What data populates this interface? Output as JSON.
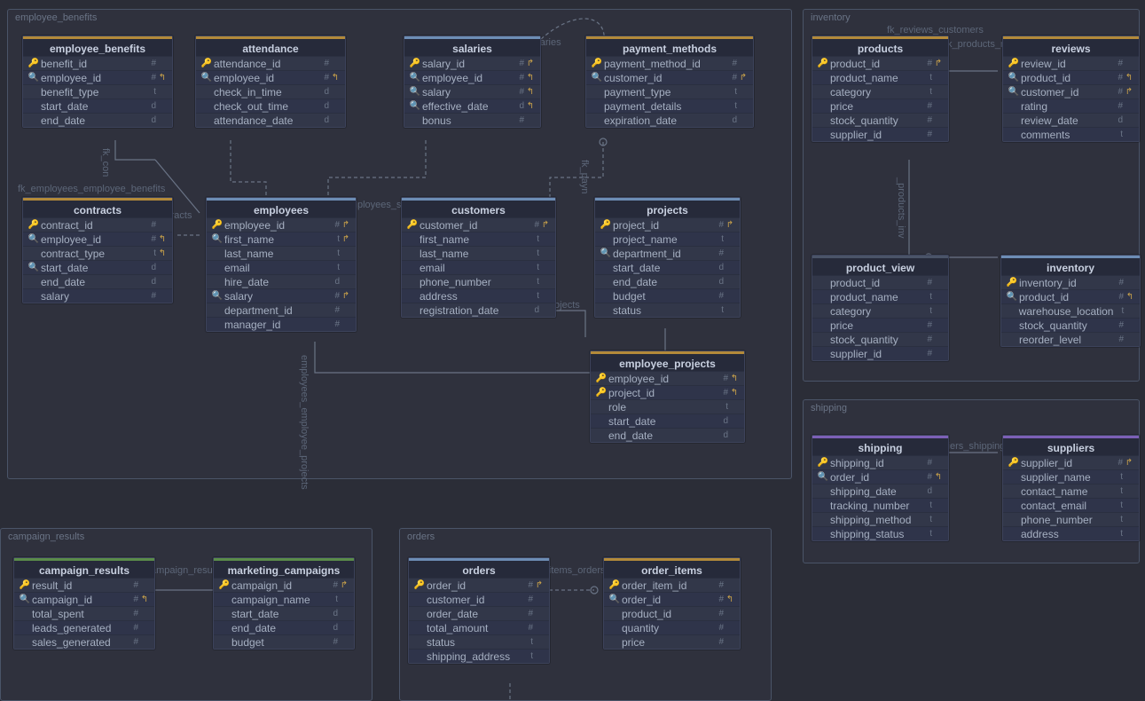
{
  "groups": {
    "employee_benefits": {
      "label": "employee_benefits"
    },
    "inventory": {
      "label": "inventory"
    },
    "shipping": {
      "label": "shipping"
    },
    "campaign_results": {
      "label": "campaign_results"
    },
    "orders": {
      "label": "orders"
    }
  },
  "entities": {
    "employee_benefits": {
      "title": "employee_benefits",
      "cols": [
        {
          "icon": "pk",
          "name": "benefit_id",
          "type": "#"
        },
        {
          "icon": "fk",
          "name": "employee_id",
          "type": "#",
          "link": "↰"
        },
        {
          "icon": "",
          "name": "benefit_type",
          "type": "t"
        },
        {
          "icon": "",
          "name": "start_date",
          "type": "d"
        },
        {
          "icon": "",
          "name": "end_date",
          "type": "d"
        }
      ]
    },
    "attendance": {
      "title": "attendance",
      "cols": [
        {
          "icon": "pk",
          "name": "attendance_id",
          "type": "#"
        },
        {
          "icon": "fk",
          "name": "employee_id",
          "type": "#",
          "link": "↰"
        },
        {
          "icon": "",
          "name": "check_in_time",
          "type": "d"
        },
        {
          "icon": "",
          "name": "check_out_time",
          "type": "d"
        },
        {
          "icon": "",
          "name": "attendance_date",
          "type": "d"
        }
      ]
    },
    "salaries": {
      "title": "salaries",
      "cols": [
        {
          "icon": "pk",
          "name": "salary_id",
          "type": "#",
          "link": "↱"
        },
        {
          "icon": "fk",
          "name": "employee_id",
          "type": "#",
          "link": "↰"
        },
        {
          "icon": "fk",
          "name": "salary",
          "type": "#",
          "link": "↰"
        },
        {
          "icon": "fk",
          "name": "effective_date",
          "type": "d",
          "link": "↰"
        },
        {
          "icon": "",
          "name": "bonus",
          "type": "#"
        }
      ]
    },
    "payment_methods": {
      "title": "payment_methods",
      "cols": [
        {
          "icon": "pk",
          "name": "payment_method_id",
          "type": "#"
        },
        {
          "icon": "fk",
          "name": "customer_id",
          "type": "#",
          "link": "↱"
        },
        {
          "icon": "",
          "name": "payment_type",
          "type": "t"
        },
        {
          "icon": "",
          "name": "payment_details",
          "type": "t"
        },
        {
          "icon": "",
          "name": "expiration_date",
          "type": "d"
        }
      ]
    },
    "contracts": {
      "title": "contracts",
      "cols": [
        {
          "icon": "pk",
          "name": "contract_id",
          "type": "#"
        },
        {
          "icon": "fk",
          "name": "employee_id",
          "type": "#",
          "link": "↰"
        },
        {
          "icon": "",
          "name": "contract_type",
          "type": "t",
          "link": "↰"
        },
        {
          "icon": "fk",
          "name": "start_date",
          "type": "d"
        },
        {
          "icon": "",
          "name": "end_date",
          "type": "d"
        },
        {
          "icon": "",
          "name": "salary",
          "type": "#"
        }
      ]
    },
    "employees": {
      "title": "employees",
      "cols": [
        {
          "icon": "pk",
          "name": "employee_id",
          "type": "#",
          "link": "↱"
        },
        {
          "icon": "fk",
          "name": "first_name",
          "type": "t",
          "link": "↱"
        },
        {
          "icon": "",
          "name": "last_name",
          "type": "t"
        },
        {
          "icon": "",
          "name": "email",
          "type": "t"
        },
        {
          "icon": "",
          "name": "hire_date",
          "type": "d"
        },
        {
          "icon": "fk",
          "name": "salary",
          "type": "#",
          "link": "↱"
        },
        {
          "icon": "",
          "name": "department_id",
          "type": "#"
        },
        {
          "icon": "",
          "name": "manager_id",
          "type": "#"
        }
      ]
    },
    "customers": {
      "title": "customers",
      "cols": [
        {
          "icon": "pk",
          "name": "customer_id",
          "type": "#",
          "link": "↱"
        },
        {
          "icon": "",
          "name": "first_name",
          "type": "t"
        },
        {
          "icon": "",
          "name": "last_name",
          "type": "t"
        },
        {
          "icon": "",
          "name": "email",
          "type": "t"
        },
        {
          "icon": "",
          "name": "phone_number",
          "type": "t"
        },
        {
          "icon": "",
          "name": "address",
          "type": "t"
        },
        {
          "icon": "",
          "name": "registration_date",
          "type": "d"
        }
      ]
    },
    "projects": {
      "title": "projects",
      "cols": [
        {
          "icon": "pk",
          "name": "project_id",
          "type": "#",
          "link": "↱"
        },
        {
          "icon": "",
          "name": "project_name",
          "type": "t"
        },
        {
          "icon": "fk",
          "name": "department_id",
          "type": "#"
        },
        {
          "icon": "",
          "name": "start_date",
          "type": "d"
        },
        {
          "icon": "",
          "name": "end_date",
          "type": "d"
        },
        {
          "icon": "",
          "name": "budget",
          "type": "#"
        },
        {
          "icon": "",
          "name": "status",
          "type": "t"
        }
      ]
    },
    "employee_projects": {
      "title": "employee_projects",
      "cols": [
        {
          "icon": "pk",
          "name": "employee_id",
          "type": "#",
          "link": "↰"
        },
        {
          "icon": "pk",
          "name": "project_id",
          "type": "#",
          "link": "↰"
        },
        {
          "icon": "",
          "name": "role",
          "type": "t"
        },
        {
          "icon": "",
          "name": "start_date",
          "type": "d"
        },
        {
          "icon": "",
          "name": "end_date",
          "type": "d"
        }
      ]
    },
    "products": {
      "title": "products",
      "cols": [
        {
          "icon": "pk",
          "name": "product_id",
          "type": "#",
          "link": "↱"
        },
        {
          "icon": "",
          "name": "product_name",
          "type": "t"
        },
        {
          "icon": "",
          "name": "category",
          "type": "t"
        },
        {
          "icon": "",
          "name": "price",
          "type": "#"
        },
        {
          "icon": "",
          "name": "stock_quantity",
          "type": "#"
        },
        {
          "icon": "",
          "name": "supplier_id",
          "type": "#"
        }
      ]
    },
    "reviews": {
      "title": "reviews",
      "cols": [
        {
          "icon": "pk",
          "name": "review_id",
          "type": "#"
        },
        {
          "icon": "fk",
          "name": "product_id",
          "type": "#",
          "link": "↰"
        },
        {
          "icon": "fk",
          "name": "customer_id",
          "type": "#",
          "link": "↱"
        },
        {
          "icon": "",
          "name": "rating",
          "type": "#"
        },
        {
          "icon": "",
          "name": "review_date",
          "type": "d"
        },
        {
          "icon": "",
          "name": "comments",
          "type": "t"
        }
      ]
    },
    "product_view": {
      "title": "product_view",
      "cols": [
        {
          "icon": "",
          "name": "product_id",
          "type": "#"
        },
        {
          "icon": "",
          "name": "product_name",
          "type": "t"
        },
        {
          "icon": "",
          "name": "category",
          "type": "t"
        },
        {
          "icon": "",
          "name": "price",
          "type": "#"
        },
        {
          "icon": "",
          "name": "stock_quantity",
          "type": "#"
        },
        {
          "icon": "",
          "name": "supplier_id",
          "type": "#"
        }
      ]
    },
    "inventory": {
      "title": "inventory",
      "cols": [
        {
          "icon": "pk",
          "name": "inventory_id",
          "type": "#"
        },
        {
          "icon": "fk",
          "name": "product_id",
          "type": "#",
          "link": "↰"
        },
        {
          "icon": "",
          "name": "warehouse_location",
          "type": "t"
        },
        {
          "icon": "",
          "name": "stock_quantity",
          "type": "#"
        },
        {
          "icon": "",
          "name": "reorder_level",
          "type": "#"
        }
      ]
    },
    "shipping": {
      "title": "shipping",
      "cols": [
        {
          "icon": "pk",
          "name": "shipping_id",
          "type": "#"
        },
        {
          "icon": "fk",
          "name": "order_id",
          "type": "#",
          "link": "↰"
        },
        {
          "icon": "",
          "name": "shipping_date",
          "type": "d"
        },
        {
          "icon": "",
          "name": "tracking_number",
          "type": "t"
        },
        {
          "icon": "",
          "name": "shipping_method",
          "type": "t"
        },
        {
          "icon": "",
          "name": "shipping_status",
          "type": "t"
        }
      ]
    },
    "suppliers": {
      "title": "suppliers",
      "cols": [
        {
          "icon": "pk",
          "name": "supplier_id",
          "type": "#",
          "link": "↱"
        },
        {
          "icon": "",
          "name": "supplier_name",
          "type": "t"
        },
        {
          "icon": "",
          "name": "contact_name",
          "type": "t"
        },
        {
          "icon": "",
          "name": "contact_email",
          "type": "t"
        },
        {
          "icon": "",
          "name": "phone_number",
          "type": "t"
        },
        {
          "icon": "",
          "name": "address",
          "type": "t"
        }
      ]
    },
    "campaign_results": {
      "title": "campaign_results",
      "cols": [
        {
          "icon": "pk",
          "name": "result_id",
          "type": "#"
        },
        {
          "icon": "fk",
          "name": "campaign_id",
          "type": "#",
          "link": "↰"
        },
        {
          "icon": "",
          "name": "total_spent",
          "type": "#"
        },
        {
          "icon": "",
          "name": "leads_generated",
          "type": "#"
        },
        {
          "icon": "",
          "name": "sales_generated",
          "type": "#"
        }
      ]
    },
    "marketing_campaigns": {
      "title": "marketing_campaigns",
      "cols": [
        {
          "icon": "pk",
          "name": "campaign_id",
          "type": "#",
          "link": "↱"
        },
        {
          "icon": "",
          "name": "campaign_name",
          "type": "t"
        },
        {
          "icon": "",
          "name": "start_date",
          "type": "d"
        },
        {
          "icon": "",
          "name": "end_date",
          "type": "d"
        },
        {
          "icon": "",
          "name": "budget",
          "type": "#"
        }
      ]
    },
    "orders": {
      "title": "orders",
      "cols": [
        {
          "icon": "pk",
          "name": "order_id",
          "type": "#",
          "link": "↱"
        },
        {
          "icon": "",
          "name": "customer_id",
          "type": "#"
        },
        {
          "icon": "",
          "name": "order_date",
          "type": "#"
        },
        {
          "icon": "",
          "name": "total_amount",
          "type": "#"
        },
        {
          "icon": "",
          "name": "status",
          "type": "t"
        },
        {
          "icon": "",
          "name": "shipping_address",
          "type": "t"
        }
      ]
    },
    "order_items": {
      "title": "order_items",
      "cols": [
        {
          "icon": "pk",
          "name": "order_item_id",
          "type": "#"
        },
        {
          "icon": "fk",
          "name": "order_id",
          "type": "#",
          "link": "↰"
        },
        {
          "icon": "",
          "name": "product_id",
          "type": "#"
        },
        {
          "icon": "",
          "name": "quantity",
          "type": "#"
        },
        {
          "icon": "",
          "name": "price",
          "type": "#"
        }
      ]
    }
  },
  "rel_labels": {
    "fk_salaries": "fk_salaries",
    "fk_contracts": "fk_con",
    "fk_employees_benefits": "fk_employees_employee_benefits",
    "fk_employees_contracts": "ees_contracts",
    "fk_employees_s": "fk_employees_s",
    "fk_payn": "fk_payn",
    "e_projects": "e_projects",
    "fk_employees_employee_projects": "employees_employee_projects",
    "fk_reviews_customers": "fk_reviews_customers",
    "fk_products_re": "fk_products_re",
    "fk_products_inv": "_products_inv",
    "pliers_shipping": "pliers_shipping",
    "campaign_results": "ampaign_results",
    "er_items_orders": "er_items_orders"
  }
}
